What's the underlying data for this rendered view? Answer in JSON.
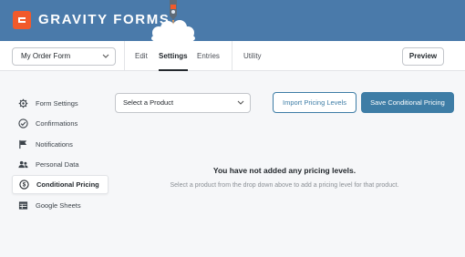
{
  "header": {
    "brand": "GRAVITY FORMS",
    "colors": {
      "header_bg": "#4a7aaa",
      "logo_accent": "#f15a2b"
    }
  },
  "toolbar": {
    "form_select_value": "My Order Form",
    "tabs": [
      {
        "label": "Edit"
      },
      {
        "label": "Settings",
        "active": true
      },
      {
        "label": "Entries"
      },
      {
        "label": "Utility"
      }
    ],
    "preview_label": "Preview"
  },
  "sidebar": {
    "items": [
      {
        "label": "Form Settings",
        "icon": "gear-icon"
      },
      {
        "label": "Confirmations",
        "icon": "check-circle-icon"
      },
      {
        "label": "Notifications",
        "icon": "flag-icon"
      },
      {
        "label": "Personal Data",
        "icon": "users-icon"
      },
      {
        "label": "Conditional Pricing",
        "icon": "dollar-icon",
        "active": true
      },
      {
        "label": "Google Sheets",
        "icon": "table-icon"
      }
    ]
  },
  "main": {
    "product_select_value": "Select a Product",
    "import_label": "Import Pricing Levels",
    "save_label": "Save Conditional Pricing",
    "empty_title": "You have not added any pricing levels.",
    "empty_desc": "Select a product from the drop down above to add a pricing level for that product.",
    "colors": {
      "primary": "#3e7da6"
    }
  }
}
